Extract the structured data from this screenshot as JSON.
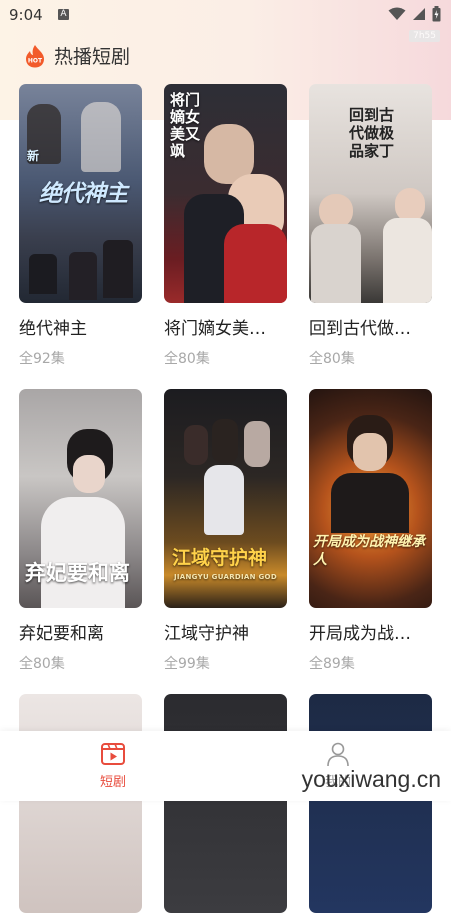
{
  "status": {
    "time": "9:04",
    "app_badge": "A",
    "net_tag": "7h55"
  },
  "section": {
    "title": "热播短剧",
    "hot_badge": "HOT"
  },
  "dramas": [
    {
      "title": "绝代神主",
      "episodes": "全92集",
      "poster_text": "绝代神主",
      "poster_tag": "新",
      "poster_colors": [
        "#5f6f86",
        "#2a3448"
      ]
    },
    {
      "title": "将门嫡女美…",
      "episodes": "全80集",
      "poster_text": "将门嫡女美又飒",
      "poster_colors": [
        "#2b2b33",
        "#4a1e22"
      ]
    },
    {
      "title": "回到古代做…",
      "episodes": "全80集",
      "poster_text": "回到古代做极品家丁",
      "poster_colors": [
        "#d9d3cf",
        "#6a6460"
      ]
    },
    {
      "title": "弃妃要和离",
      "episodes": "全80集",
      "poster_text": "弃妃要和离",
      "poster_colors": [
        "#b9b6b5",
        "#5e5a5a"
      ]
    },
    {
      "title": "江域守护神",
      "episodes": "全99集",
      "poster_text": "江域守护神",
      "poster_subtext": "JIANGYU GUARDIAN GOD",
      "poster_colors": [
        "#2a2320",
        "#6b4a20"
      ]
    },
    {
      "title": "开局成为战…",
      "episodes": "全89集",
      "poster_text": "开局成为战神继承人",
      "poster_colors": [
        "#3a2418",
        "#8c4a1c"
      ]
    }
  ],
  "partial_posters": [
    {
      "poster_colors": [
        "#ece6e4",
        "#cfc3bf"
      ]
    },
    {
      "poster_colors": [
        "#2b2b2f",
        "#3c3c40"
      ]
    },
    {
      "poster_colors": [
        "#1d2a44",
        "#233660"
      ]
    }
  ],
  "tabs": [
    {
      "label": "短剧",
      "icon": "play-video-icon",
      "active": true,
      "color": "#e84c3d"
    },
    {
      "label": "我的",
      "icon": "profile-icon",
      "active": false,
      "color": "#999999"
    }
  ],
  "watermark": "youxiwang.cn"
}
